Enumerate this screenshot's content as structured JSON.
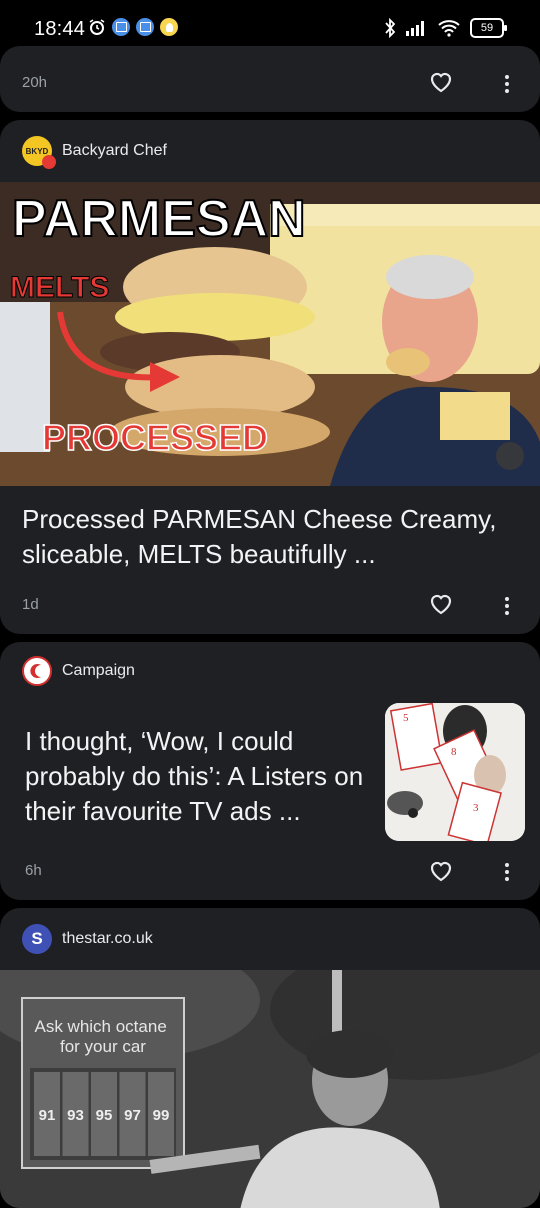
{
  "status_bar": {
    "time": "18:44",
    "battery": "59"
  },
  "cards": [
    {
      "timestamp": "20h"
    },
    {
      "source": "Backyard Chef",
      "logo_text": "BKYD",
      "image_texts": {
        "top": "PARMESAN",
        "melts": "MELTS",
        "processed": "PROCESSED"
      },
      "headline": "Processed PARMESAN Cheese Creamy, sliceable, MELTS beautifully ...",
      "timestamp": "1d"
    },
    {
      "source": "Campaign",
      "headline": "I thought, ‘Wow, I could probably do this’: A Listers on their favourite TV ads ...",
      "timestamp": "6h"
    },
    {
      "source": "thestar.co.uk",
      "logo_letter": "S",
      "sign_text": "Ask which octane for your car",
      "octanes": [
        "91",
        "93",
        "95",
        "97",
        "99"
      ]
    }
  ],
  "colors": {
    "card_bg": "#1f2023",
    "page_bg": "#000000",
    "meta_text": "#9aa0a6"
  },
  "icons": [
    "alarm-icon",
    "calendar-icon",
    "bluetooth-icon",
    "signal-icon",
    "wifi-icon",
    "heart-icon",
    "more-vert-icon"
  ]
}
